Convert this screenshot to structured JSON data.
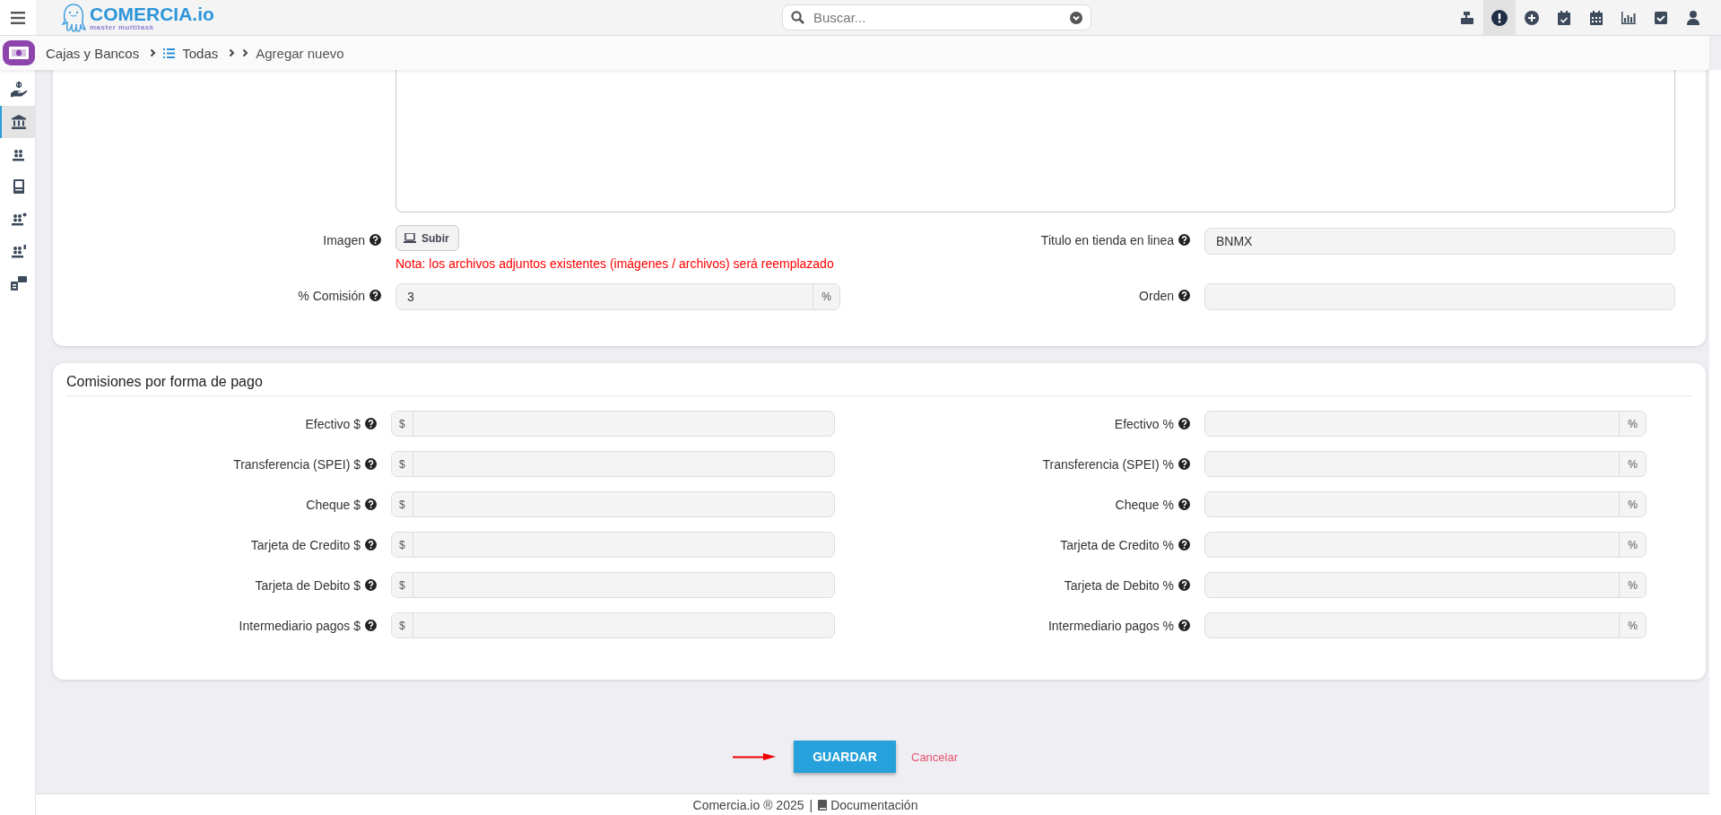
{
  "topbar": {
    "logo": {
      "name": "COMERCIA.io",
      "tagline": "master multitask"
    },
    "search": {
      "placeholder": "Buscar..."
    },
    "actions": [
      {
        "kind": "register",
        "selected": false
      },
      {
        "kind": "alert",
        "selected": true
      },
      {
        "kind": "add",
        "selected": false
      },
      {
        "kind": "calendar-check",
        "selected": false
      },
      {
        "kind": "calendar",
        "selected": false
      },
      {
        "kind": "chart",
        "selected": false
      },
      {
        "kind": "check",
        "selected": false
      },
      {
        "kind": "user",
        "selected": false
      }
    ]
  },
  "breadcrumb": [
    {
      "kind": "module",
      "label": "Cajas y Bancos"
    },
    {
      "kind": "list",
      "label": "Todas"
    },
    {
      "kind": "plain",
      "label": "Agregar nuevo"
    }
  ],
  "sidebar": {
    "items": [
      {
        "kind": "hand",
        "selected": false
      },
      {
        "kind": "bank",
        "selected": true
      },
      {
        "kind": "grid",
        "selected": false
      },
      {
        "kind": "book",
        "selected": false
      },
      {
        "kind": "grid-p",
        "selected": false
      },
      {
        "kind": "grid-u",
        "selected": false
      },
      {
        "kind": "cards",
        "selected": false
      }
    ]
  },
  "details": {
    "image": {
      "label": "Imagen",
      "button": "Subir",
      "note": "Nota: los archivos adjuntos existentes (imágenes / archivos) será reemplazado"
    },
    "store_title": {
      "label": "Titulo en tienda en linea",
      "value": "BNMX"
    },
    "commission": {
      "label": "% Comisión",
      "value": "3",
      "suffix": "%"
    },
    "order": {
      "label": "Orden"
    }
  },
  "commissions": {
    "title": "Comisiones por forma de pago",
    "rows": [
      {
        "left": {
          "label": "Efectivo $",
          "prefix": "$"
        },
        "right": {
          "label": "Efectivo %",
          "suffix": "%"
        }
      },
      {
        "left": {
          "label": "Transferencia (SPEI) $",
          "prefix": "$"
        },
        "right": {
          "label": "Transferencia (SPEI) %",
          "suffix": "%"
        }
      },
      {
        "left": {
          "label": "Cheque $",
          "prefix": "$"
        },
        "right": {
          "label": "Cheque %",
          "suffix": "%"
        }
      },
      {
        "left": {
          "label": "Tarjeta de Credito $",
          "prefix": "$"
        },
        "right": {
          "label": "Tarjeta de Credito %",
          "suffix": "%"
        }
      },
      {
        "left": {
          "label": "Tarjeta de Debito $",
          "prefix": "$"
        },
        "right": {
          "label": "Tarjeta de Debito %",
          "suffix": "%"
        }
      },
      {
        "left": {
          "label": "Intermediario pagos $",
          "prefix": "$"
        },
        "right": {
          "label": "Intermediario pagos %",
          "suffix": "%"
        }
      }
    ]
  },
  "actions": {
    "save": "GUARDAR",
    "cancel": "Cancelar"
  },
  "footer": {
    "copyright": "Comercia.io ® 2025",
    "separator": "|",
    "link": "Documentación"
  }
}
